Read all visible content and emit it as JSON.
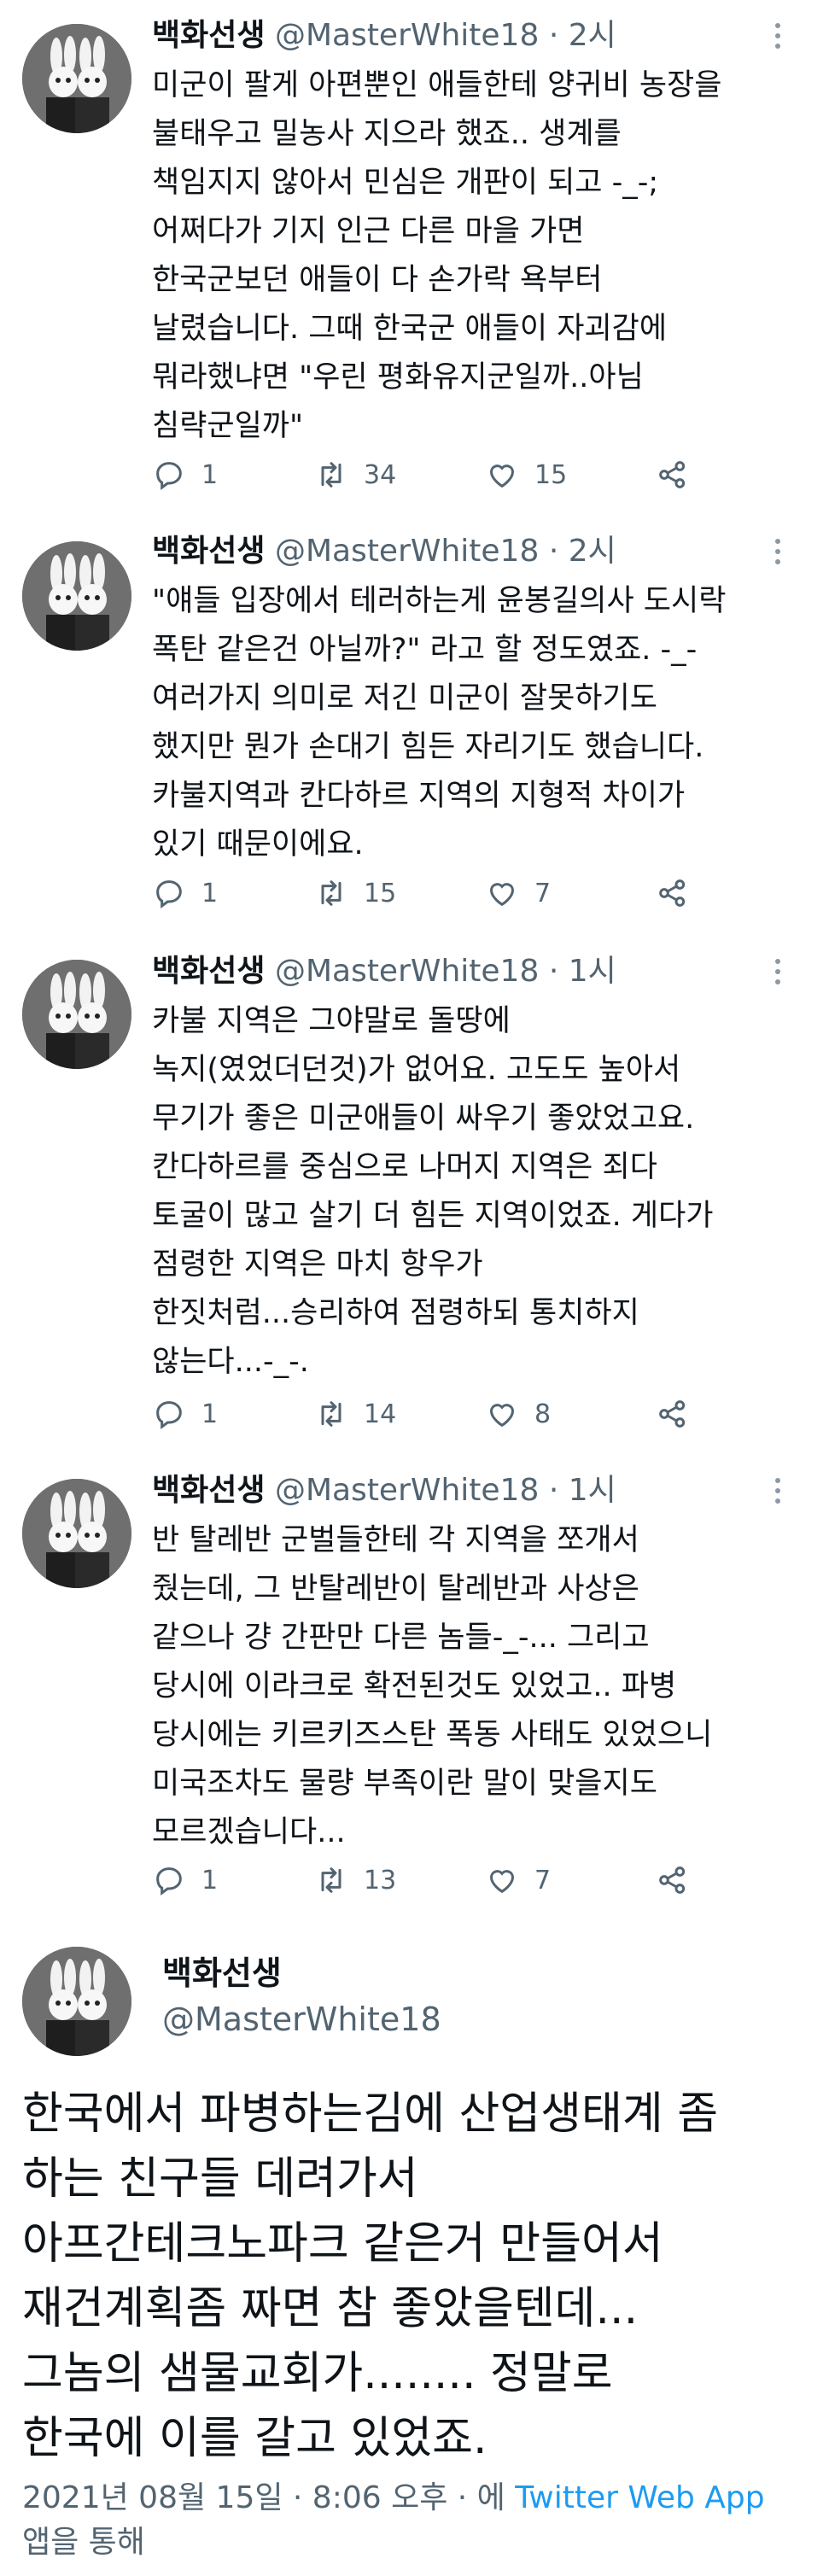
{
  "tweets": [
    {
      "name": "백화선생",
      "handle": "@MasterWhite18",
      "time": "· 2시",
      "lines": [
        "미군이 팔게 아편뿐인 애들한테 양귀비 농장을",
        "불태우고 밀농사 지으라 했죠..  생계를",
        "책임지지 않아서 민심은 개판이 되고 -_-;",
        "어쩌다가 기지 인근 다른 마을 가면",
        "한국군보던 애들이 다 손가락 욕부터",
        "날렸습니다. 그때 한국군 애들이 자괴감에",
        "뭐라했냐면 \"우린 평화유지군일까..아님",
        "침략군일까\""
      ],
      "replies": "1",
      "retweets": "34",
      "likes": "15"
    },
    {
      "name": "백화선생",
      "handle": "@MasterWhite18",
      "time": "· 2시",
      "lines": [
        "\"얘들 입장에서 테러하는게 윤봉길의사 도시락",
        "폭탄 같은건 아닐까?\" 라고 할 정도였죠. -_-",
        "여러가지 의미로 저긴 미군이 잘못하기도",
        "했지만 뭔가 손대기 힘든 자리기도 했습니다.",
        "카불지역과 칸다하르 지역의 지형적 차이가",
        "있기 때문이에요."
      ],
      "replies": "1",
      "retweets": "15",
      "likes": "7"
    },
    {
      "name": "백화선생",
      "handle": "@MasterWhite18",
      "time": "· 1시",
      "lines": [
        "카불 지역은 그야말로 돌땅에",
        "녹지(였었더던것)가 없어요. 고도도 높아서",
        "무기가 좋은 미군애들이 싸우기 좋았었고요.",
        "칸다하르를 중심으로 나머지 지역은 죄다",
        "토굴이 많고 살기 더 힘든 지역이었죠. 게다가",
        "점령한 지역은 마치 항우가",
        "한짓처럼...승리하여 점령하되 통치하지",
        "않는다...-_-."
      ],
      "replies": "1",
      "retweets": "14",
      "likes": "8"
    },
    {
      "name": "백화선생",
      "handle": "@MasterWhite18",
      "time": "· 1시",
      "lines": [
        "반 탈레반 군벌들한테 각 지역을 쪼개서",
        "줬는데, 그 반탈레반이 탈레반과 사상은",
        "같으나 걍 간판만 다른 놈들-_-... 그리고",
        "당시에 이라크로 확전된것도 있었고.. 파병",
        "당시에는 키르키즈스탄 폭동 사태도 있었으니",
        "미국조차도 물량 부족이란 말이 맞을지도",
        "모르겠습니다..."
      ],
      "replies": "1",
      "retweets": "13",
      "likes": "7"
    }
  ],
  "main_tweet": {
    "name": "백화선생",
    "handle": "@MasterWhite18",
    "lines": [
      "한국에서 파병하는김에 산업생태계 좀",
      "하는 친구들 데려가서",
      "아프간테크노파크 같은거 만들어서",
      "재건계획좀 짜면 참 좋았을텐데...",
      "그놈의 샘물교회가........ 정말로",
      "한국에 이를 갈고 있었죠."
    ],
    "meta_prefix": "2021년 08월 15일 · 8:06 오후 · 에 ",
    "app": "Twitter Web App",
    "meta_suffix": "앱을 통해"
  },
  "colors": {
    "text": "#0f1419",
    "secondary": "#536471",
    "link": "#1d9bf0"
  },
  "icons": {
    "reply": "reply-icon",
    "retweet": "retweet-icon",
    "like": "heart-icon",
    "share": "share-icon",
    "more": "more-icon"
  }
}
